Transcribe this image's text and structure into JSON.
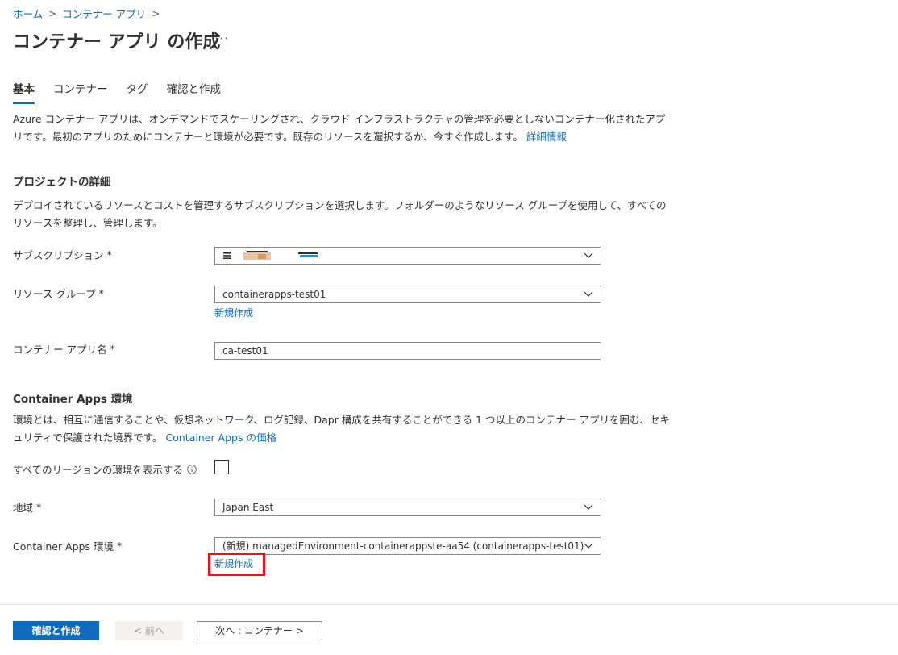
{
  "breadcrumb": {
    "items": [
      "ホーム",
      "コンテナー アプリ"
    ],
    "separator": ">"
  },
  "page": {
    "title": "コンテナー アプリ の作成",
    "more": "···"
  },
  "tabs": [
    "基本",
    "コンテナー",
    "タグ",
    "確認と作成"
  ],
  "intro": {
    "text": "Azure コンテナー アプリは、オンデマンドでスケーリングされ、クラウド インフラストラクチャの管理を必要としないコンテナー化されたアプリです。最初のアプリのためにコンテナーと環境が必要です。既存のリソースを選択するか、今すぐ作成します。",
    "link": "詳細情報"
  },
  "project": {
    "heading": "プロジェクトの詳細",
    "description": "デプロイされているリソースとコストを管理するサブスクリプションを選択します。フォルダーのようなリソース グループを使用して、すべてのリソースを整理し、管理します。",
    "subscription_label": "サブスクリプション",
    "resource_group_label": "リソース グループ",
    "resource_group_value": "containerapps-test01",
    "create_new": "新規作成",
    "app_name_label": "コンテナー アプリ名",
    "app_name_value": "ca-test01"
  },
  "environment": {
    "heading": "Container Apps 環境",
    "description": "環境とは、相互に通信することや、仮想ネットワーク、ログ記録、Dapr 構成を共有することができる 1 つ以上のコンテナー アプリを囲む、セキュリティで保護された境界です。",
    "pricing_link": "Container Apps の価格",
    "show_all_label": "すべてのリージョンの環境を表示する",
    "region_label": "地域",
    "region_value": "Japan East",
    "env_label": "Container Apps 環境",
    "env_value": "(新規) managedEnvironment-containerappste-aa54 (containerapps-test01)",
    "create_new": "新規作成"
  },
  "required_mark": "*",
  "footer": {
    "review_create": "確認と作成",
    "previous": "< 前へ",
    "next": "次へ : コンテナー >"
  },
  "colors": {
    "accent": "#0f6cbd",
    "highlight": "#e81123"
  }
}
